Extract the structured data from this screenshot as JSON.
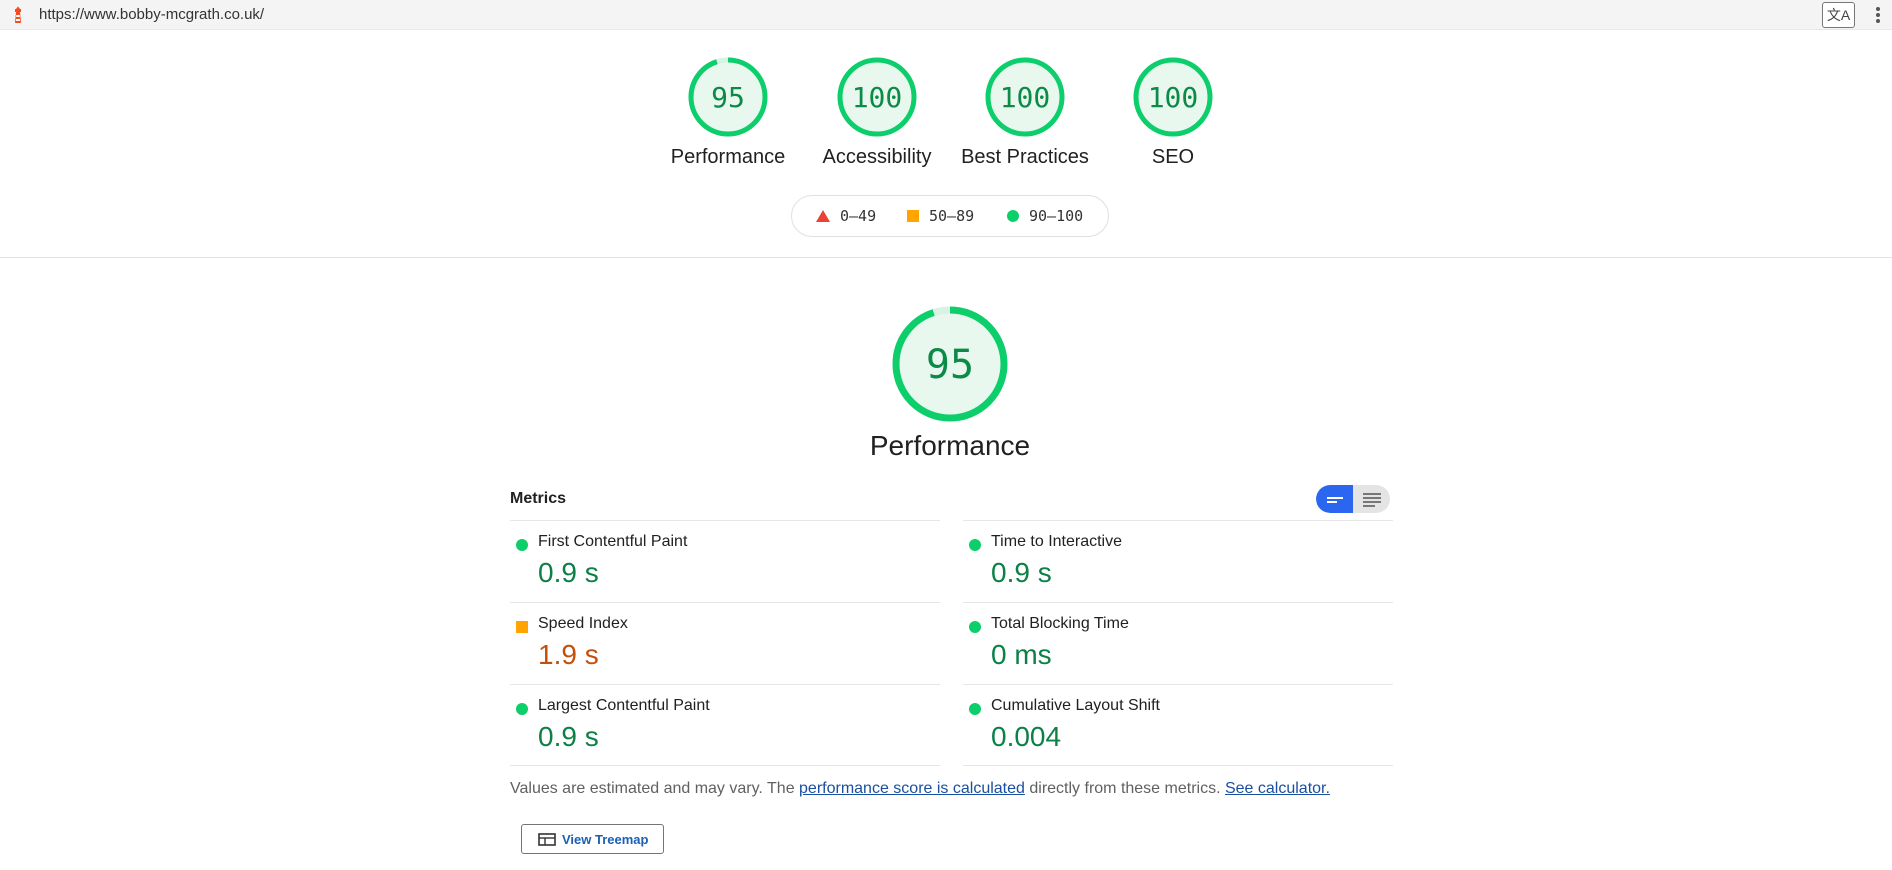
{
  "topbar": {
    "url": "https://www.bobby-mcgrath.co.uk/",
    "translate_glyph": "文A"
  },
  "categories": [
    {
      "score": "95",
      "label": "Performance"
    },
    {
      "score": "100",
      "label": "Accessibility"
    },
    {
      "score": "100",
      "label": "Best Practices"
    },
    {
      "score": "100",
      "label": "SEO"
    }
  ],
  "legend": {
    "fail": "0–49",
    "average": "50–89",
    "pass": "90–100"
  },
  "performance": {
    "score": "95",
    "score_fraction": 0.95,
    "title": "Performance"
  },
  "metrics": {
    "title": "Metrics",
    "items": [
      {
        "label": "First Contentful Paint",
        "value": "0.9 s",
        "rating": "pass"
      },
      {
        "label": "Time to Interactive",
        "value": "0.9 s",
        "rating": "pass"
      },
      {
        "label": "Speed Index",
        "value": "1.9 s",
        "rating": "average"
      },
      {
        "label": "Total Blocking Time",
        "value": "0 ms",
        "rating": "pass"
      },
      {
        "label": "Largest Contentful Paint",
        "value": "0.9 s",
        "rating": "pass"
      },
      {
        "label": "Cumulative Layout Shift",
        "value": "0.004",
        "rating": "pass"
      }
    ]
  },
  "note": {
    "part1": "Values are estimated and may vary. The ",
    "link1": "performance score is calculated",
    "part2": " directly from these metrics. ",
    "link2": "See calculator."
  },
  "treemap_button": "View Treemap",
  "colors": {
    "pass": "#0cce6b",
    "average": "#ffa400",
    "fail": "#eb4236",
    "toggle_active": "#2a66f0"
  }
}
